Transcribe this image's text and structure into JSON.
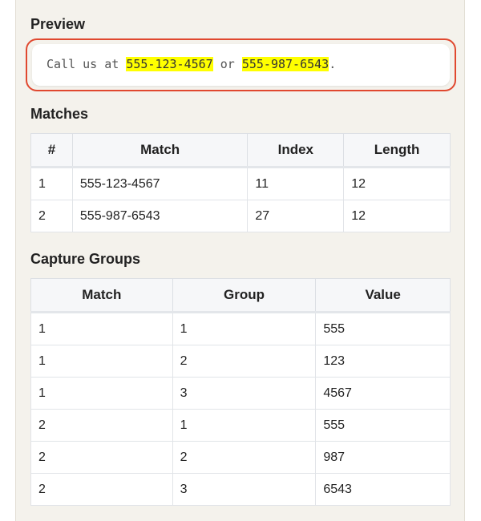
{
  "preview": {
    "title": "Preview",
    "text_before": "Call us at ",
    "match1": "555-123-4567",
    "text_middle": " or ",
    "match2": "555-987-6543",
    "text_after": "."
  },
  "matches": {
    "title": "Matches",
    "headers": [
      "#",
      "Match",
      "Index",
      "Length"
    ],
    "rows": [
      [
        "1",
        "555-123-4567",
        "11",
        "12"
      ],
      [
        "2",
        "555-987-6543",
        "27",
        "12"
      ]
    ]
  },
  "groups": {
    "title": "Capture Groups",
    "headers": [
      "Match",
      "Group",
      "Value"
    ],
    "rows": [
      [
        "1",
        "1",
        "555"
      ],
      [
        "1",
        "2",
        "123"
      ],
      [
        "1",
        "3",
        "4567"
      ],
      [
        "2",
        "1",
        "555"
      ],
      [
        "2",
        "2",
        "987"
      ],
      [
        "2",
        "3",
        "6543"
      ]
    ]
  },
  "colors": {
    "panel_bg": "#f4f2ec",
    "highlight": "#ffff00",
    "focus_border": "#e0482f"
  }
}
